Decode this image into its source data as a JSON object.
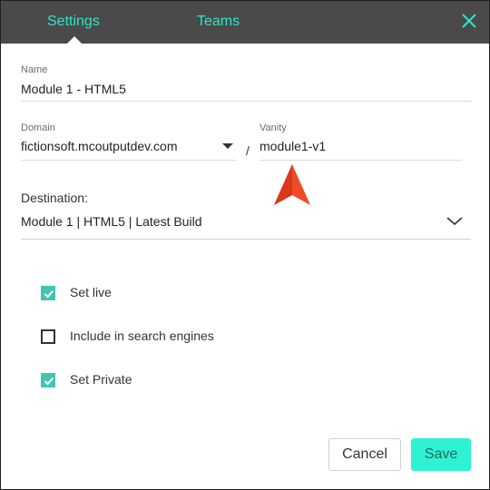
{
  "header": {
    "tabs": [
      {
        "label": "Settings",
        "active": true
      },
      {
        "label": "Teams",
        "active": false
      }
    ],
    "close_icon": "close-icon",
    "accent_color": "#2ee6c8",
    "background_color": "#4a4a4a"
  },
  "form": {
    "name": {
      "label": "Name",
      "value": "Module 1 - HTML5"
    },
    "domain": {
      "label": "Domain",
      "value": "fictionsoft.mcoutputdev.com"
    },
    "separator": "/",
    "vanity": {
      "label": "Vanity",
      "value": "module1-v1"
    },
    "destination": {
      "label": "Destination:",
      "value": "Module 1 | HTML5 | Latest Build"
    }
  },
  "options": [
    {
      "label": "Set live",
      "checked": true
    },
    {
      "label": "Include in search engines",
      "checked": false
    },
    {
      "label": "Set Private",
      "checked": true
    }
  ],
  "checkbox_color": "#42c4b1",
  "footer": {
    "cancel_label": "Cancel",
    "save_label": "Save",
    "save_color": "#2ef2d3"
  },
  "cursor_color": "#f04a26"
}
